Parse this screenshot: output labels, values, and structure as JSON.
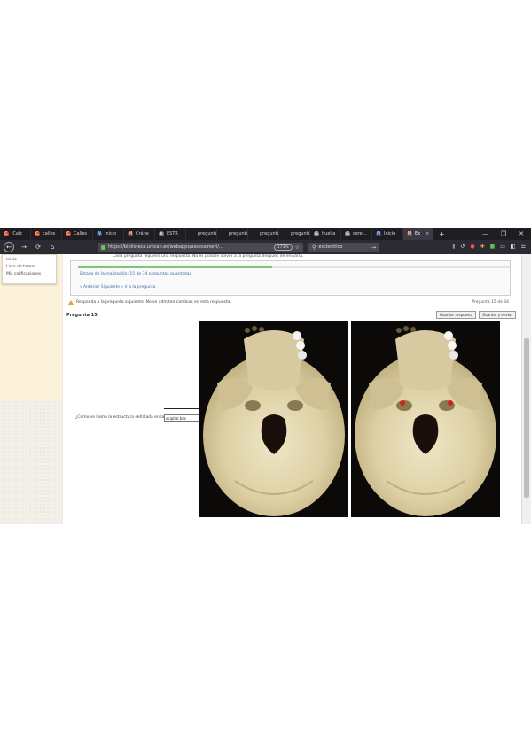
{
  "tabs": [
    {
      "label": "iCalc",
      "color": "#d34b2a",
      "icon": "C"
    },
    {
      "label": "calles",
      "color": "#d34b2a",
      "icon": "C"
    },
    {
      "label": "Calles",
      "color": "#d34b2a",
      "icon": "C"
    },
    {
      "label": "Inicio",
      "color": "#2a4e9b",
      "icon": "N"
    },
    {
      "label": "Cráne",
      "color": "#8b4a2a",
      "icon": "M"
    },
    {
      "label": "ESTR",
      "color": "#777777",
      "icon": "e"
    },
    {
      "label": "preguntas",
      "color": "",
      "icon": ""
    },
    {
      "label": "preguntas",
      "color": "",
      "icon": ""
    },
    {
      "label": "preguntas",
      "color": "",
      "icon": ""
    },
    {
      "label": "preguntas",
      "color": "",
      "icon": ""
    },
    {
      "label": "huella",
      "color": "#888888",
      "icon": "G"
    },
    {
      "label": "cere...",
      "color": "#888888",
      "icon": "G"
    },
    {
      "label": "Inicio",
      "color": "#2a4e9b",
      "icon": "N"
    },
    {
      "label": "Ex",
      "color": "#8b4a2a",
      "icon": "M",
      "active": true
    }
  ],
  "window_controls": [
    "—",
    "❐",
    "✕"
  ],
  "toolbar": {
    "back": "←",
    "forward": "→",
    "reload": "⟳",
    "home": "⌂",
    "url": "https://biblioteca.unican.es/webapps/assessment/...",
    "zoom": "175%",
    "search_query": "esclerótico"
  },
  "sidebar_menu": [
    "Inicio",
    "Lista de tareas",
    "Mis calificaciones"
  ],
  "page": {
    "top_note": "Cada pregunta requiere una respuesta. No es posible volver a la pregunta después de enviarla.",
    "progress_fraction": 0.45,
    "progress_text": "Estado de la realización: 15 de 34 preguntas guardadas",
    "nav_link": "« Anterior   Siguiente »   Ir a la pregunta",
    "notice": "Responda a la pregunta siguiente. No se admiten cambios en esta respuesta.",
    "question_counter": "Pregunta 15 de 34",
    "question_title": "Pregunta 15",
    "buttons": [
      "Guardar respuesta",
      "Guardar y enviar"
    ],
    "question_text": "¿Cómo se llama la estructura señalada en la base del cráneo?",
    "answer_value": "ocipital bas"
  },
  "colors": {
    "tabbar": "#1d1d22",
    "navbar": "#2b2a33",
    "sidebar": "#fdf2dc",
    "progress": "#7bc67a",
    "link": "#3a6aa8"
  }
}
